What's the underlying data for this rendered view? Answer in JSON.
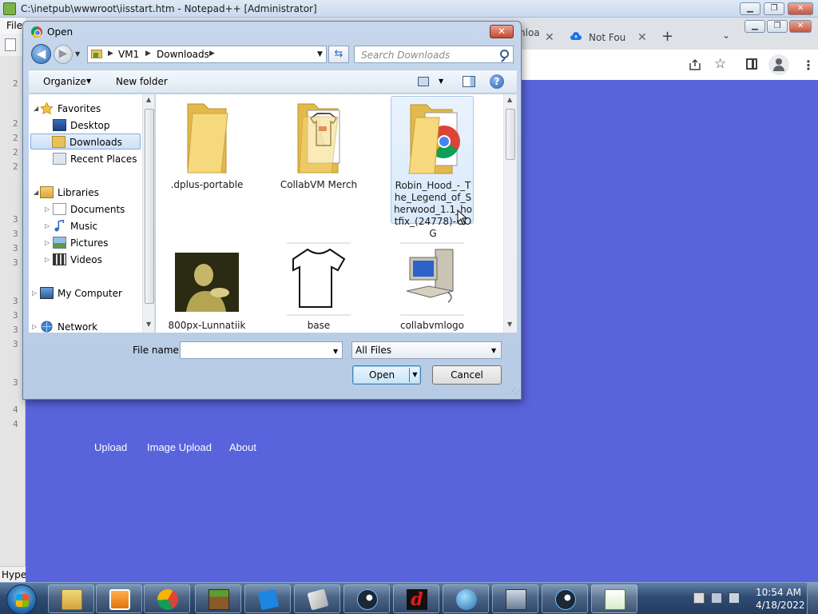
{
  "notepad": {
    "title": "C:\\inetpub\\wwwroot\\iisstart.htm - Notepad++ [Administrator]",
    "menu_file": "File",
    "gutter_lines": [
      "2",
      "2",
      "2",
      "2",
      "2",
      "3",
      "3",
      "3",
      "3",
      "3",
      "3",
      "3",
      "3",
      "3",
      "4",
      "4"
    ],
    "status_text": "Hype",
    "win_min": "▁",
    "win_max": "❐",
    "win_close": "✕"
  },
  "chrome": {
    "tab_1_label": "nloa",
    "tab_2_label": "Not Fou",
    "tab_close": "✕",
    "new_tab": "+",
    "tab_list": "⌄",
    "win_min": "▁",
    "win_max": "❐",
    "win_close": "✕",
    "menu": "⋮",
    "star": "☆",
    "links": {
      "upload": "Upload",
      "image_upload": "Image Upload",
      "about": "About"
    }
  },
  "dialog": {
    "title": "Open",
    "close": "✕",
    "back": "◀",
    "forward": "▶",
    "breadcrumb": [
      "VM1",
      "Downloads"
    ],
    "sep": "▶",
    "dropdown": "▼",
    "refresh": "⇆",
    "search_placeholder": "Search Downloads",
    "organize": "Organize",
    "new_folder": "New folder",
    "arrow_down": "▼",
    "help": "?",
    "nav": {
      "favorites": "Favorites",
      "desktop": "Desktop",
      "downloads": "Downloads",
      "recent_places": "Recent Places",
      "libraries": "Libraries",
      "documents": "Documents",
      "music": "Music",
      "pictures": "Pictures",
      "videos": "Videos",
      "my_computer": "My Computer",
      "network": "Network",
      "expand_open": "◢",
      "expand_closed": "▷"
    },
    "files": [
      {
        "name": ".dplus-portable",
        "kind": "folder"
      },
      {
        "name": "CollabVM Merch",
        "kind": "folder-tshirt"
      },
      {
        "name": "Robin_Hood_-_The_Legend_of_Sherwood_1.1_hotfix_(24778)-GOG",
        "kind": "folder-chrome",
        "selected": true
      },
      {
        "name": "800px-Lunnatiik_the_retard",
        "kind": "image-photo"
      },
      {
        "name": "base",
        "kind": "image-tshirt"
      },
      {
        "name": "collabvmlogo",
        "kind": "image-computer"
      }
    ],
    "scroll_up": "▲",
    "scroll_down": "▼",
    "file_name_label": "File name:",
    "file_name_value": "",
    "file_type": "All Files",
    "open_label": "Open",
    "cancel_label": "Cancel",
    "grip": "⋰⋰"
  },
  "taskbar": {
    "time": "10:54 AM",
    "date": "4/18/2022",
    "apps": [
      "file-explorer-icon",
      "media-player-icon",
      "chrome-icon",
      "minecraft-icon",
      "roblox-icon",
      "disc-icon",
      "steam-icon",
      "dplus-icon",
      "globe-d-icon",
      "tool-icon",
      "steam-icon",
      "notepad-plus-plus-icon"
    ]
  },
  "colors": {
    "web_background": "#5963dc",
    "dialog_frame": "#b7cbe4",
    "taskbar": "#2f4b72"
  }
}
